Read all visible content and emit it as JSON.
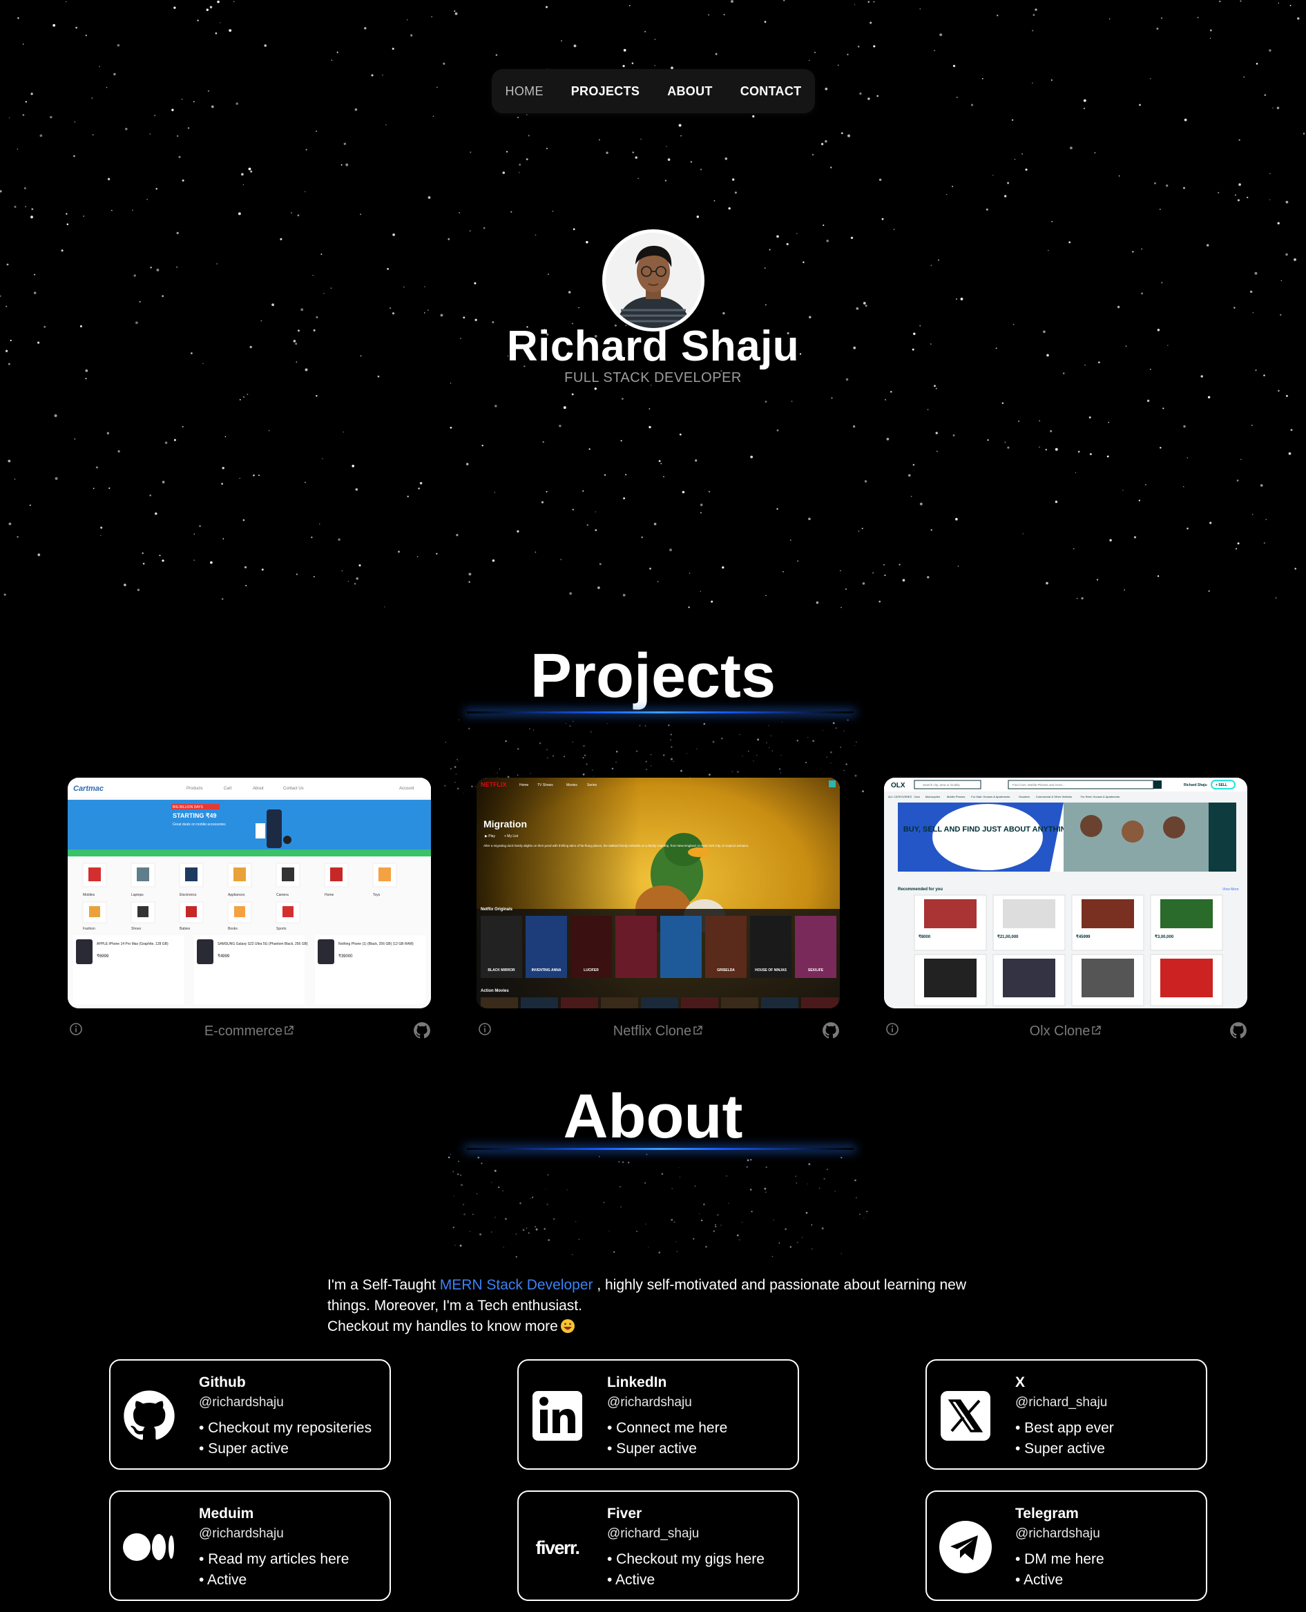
{
  "nav": {
    "items": [
      {
        "label": "HOME"
      },
      {
        "label": "PROJECTS"
      },
      {
        "label": "ABOUT"
      },
      {
        "label": "CONTACT"
      }
    ]
  },
  "hero": {
    "name": "Richard Shaju",
    "role": "FULL STACK DEVELOPER"
  },
  "projects": {
    "title": "Projects",
    "items": [
      {
        "label": "E-commerce"
      },
      {
        "label": "Netflix Clone"
      },
      {
        "label": "Olx Clone"
      }
    ]
  },
  "about": {
    "title": "About",
    "line1_pre": "I'm a Self-Taught ",
    "line1_highlight": "MERN Stack Developer",
    "line1_post": " , highly self-motivated and passionate about learning new",
    "line2": "things. Moreover, I'm a Tech enthusiast.",
    "line3": "Checkout my handles to know more"
  },
  "socials": [
    {
      "name": "Github",
      "handle": "@richardshaju",
      "b1": "• Checkout my reposit­eries",
      "b2": "• Super active",
      "icon": "github-icon"
    },
    {
      "name": "LinkedIn",
      "handle": "@richardshaju",
      "b1": "• Connect me here",
      "b2": "• Super active",
      "icon": "linkedin-icon"
    },
    {
      "name": "X",
      "handle": "@richard_shaju",
      "b1": "• Best app ever",
      "b2": "• Super active",
      "icon": "x-icon"
    },
    {
      "name": "Meduim",
      "handle": "@richardshaju",
      "b1": "• Read my articles here",
      "b2": "• Active",
      "icon": "medium-icon"
    },
    {
      "name": "Fiver",
      "handle": "@richard_shaju",
      "b1": "• Checkout my gigs here",
      "b2": "• Active",
      "icon": "fiverr-icon"
    },
    {
      "name": "Telegram",
      "handle": "@richardshaju",
      "b1": "• DM me here",
      "b2": "• Active",
      "icon": "telegram-icon"
    }
  ],
  "shots": {
    "ecom": {
      "logo": "Cartmac",
      "nav": [
        "Products",
        "Cart",
        "About",
        "Contact Us"
      ],
      "account": "Account",
      "banner_tag": "BIG BILLION DAYS",
      "banner_title": "STARTING ₹49",
      "banner_sub": "Great deals on mobile accessories",
      "categories": [
        "Mobiles",
        "Laptops",
        "Electronics",
        "Appliances",
        "Camera",
        "Home",
        "Toys"
      ],
      "categories2": [
        "Fashion",
        "Shoes",
        "Babies",
        "Books",
        "Sports"
      ],
      "products": [
        {
          "name": "APPLE iPhone 14 Pro Max (Graphite, 128 GB)",
          "price": "₹6999"
        },
        {
          "name": "SAMSUNG Galaxy S22 Ultra 5G (Phantom Black, 256 GB)",
          "price": "₹4999"
        },
        {
          "name": "Nothing Phone (1) (Black, 256 GB) (12 GB RAM)",
          "price": "₹39000"
        }
      ]
    },
    "netflix": {
      "logo": "NETFLIX",
      "nav": [
        "Home",
        "TV Shows",
        "Movies",
        "Series"
      ],
      "title": "Migration",
      "btn1": "▶ Play",
      "btn2": "+ My List",
      "desc": "After a migrating duck family alights on their pond with thrilling tales of far-flung places, the Mallard family embarks on a family road trip, from New England, to New York City, to tropical Jamaica.",
      "row1": "Netflix Originals",
      "row2": "Action Movies",
      "posters": [
        "BLACK MIRROR",
        "INVENTING ANNA",
        "LUCIFER",
        "",
        "",
        "GRISELDA",
        "HOUSE OF NINJAS",
        "SEX/LIFE"
      ]
    },
    "olx": {
      "logo": "OLX",
      "search1": "Search city, area or locality",
      "search2": "Find Cars, Mobile Phones and more...",
      "user": "Richard Shaju",
      "sell": "+ SELL",
      "cats": [
        "ALL CATEGORIES",
        "Cars",
        "Motorcycles",
        "Mobile Phones",
        "For Sale: Houses & Apartments",
        "Scooters",
        "Commercial & Other Vehicles",
        "For Rent: Houses & Apartments"
      ],
      "hero": "BUY, SELL AND FIND JUST ABOUT ANYTHING",
      "rec": "Recommended for you",
      "more": "View More",
      "prices": [
        "₹8000",
        "₹21,00,000",
        "₹45999",
        "₹3,00,000"
      ]
    }
  },
  "colors": {
    "background": "#000000",
    "accent_blue": "#3b82f6",
    "muted": "#7a7a7a",
    "nav_bg": "#151515"
  }
}
